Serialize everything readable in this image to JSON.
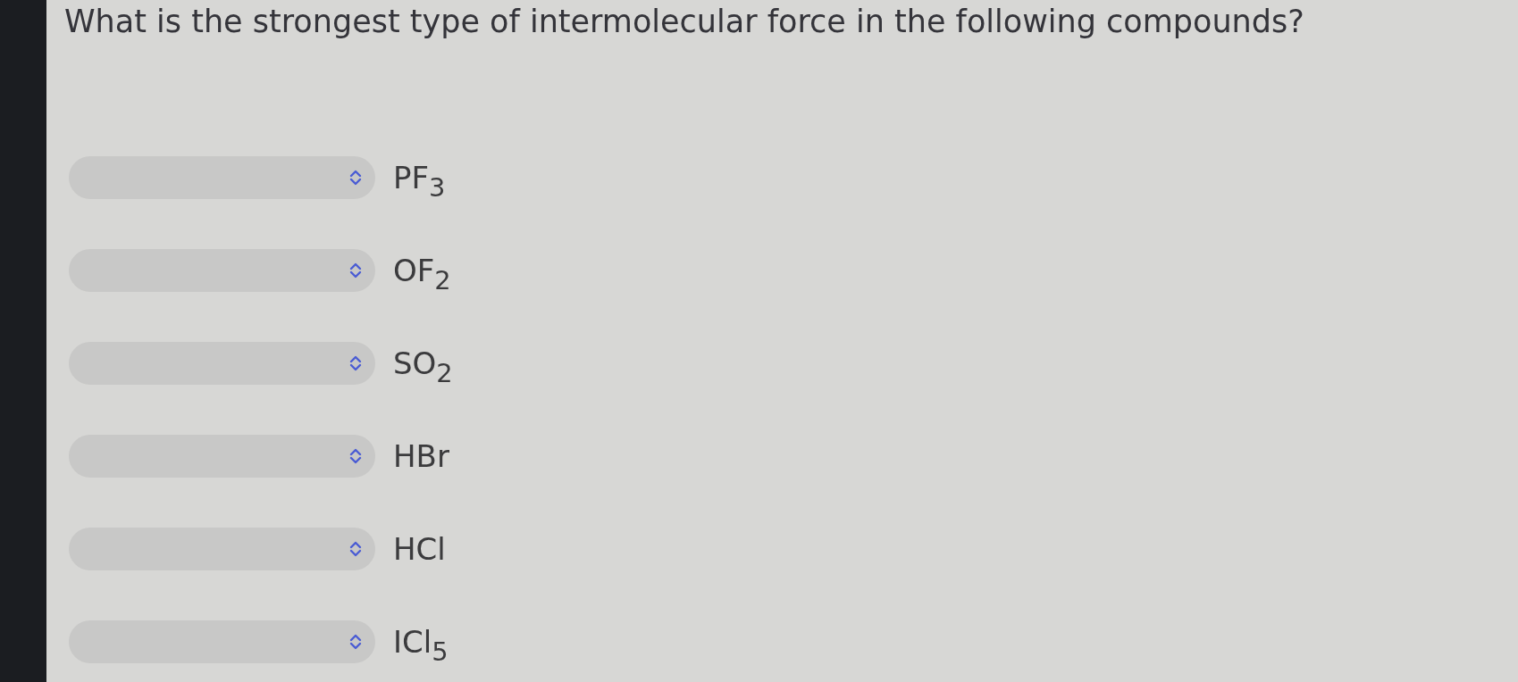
{
  "question": "What is the strongest type of intermolecular force in the following compounds?",
  "items": [
    {
      "compound": "PF$_{3}$"
    },
    {
      "compound": "OF$_{2}$"
    },
    {
      "compound": "SO$_{2}$"
    },
    {
      "compound": "HBr"
    },
    {
      "compound": "HCl"
    },
    {
      "compound": "ICl$_{5}$"
    }
  ]
}
